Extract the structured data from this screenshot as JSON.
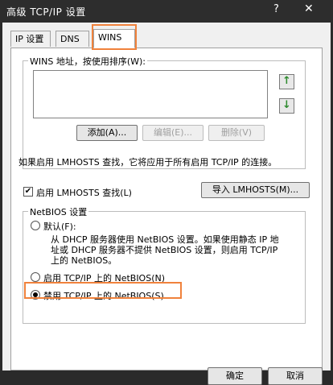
{
  "window": {
    "title": "高级 TCP/IP 设置",
    "help_glyph": "?",
    "close_glyph": "✕"
  },
  "tabs": [
    {
      "label": "IP 设置"
    },
    {
      "label": "DNS"
    },
    {
      "label": "WINS",
      "active": true
    }
  ],
  "wins_address": {
    "group_label": "WINS 地址，按使用排序(W):",
    "up_glyph": "↑",
    "down_glyph": "↓",
    "add_label": "添加(A)...",
    "edit_label": "编辑(E)...",
    "delete_label": "删除(V)"
  },
  "lmhosts": {
    "description": "如果启用 LMHOSTS 查找，它将应用于所有启用 TCP/IP 的连接。",
    "enable_label": "启用 LMHOSTS 查找(L)",
    "enable_checked": true,
    "check_glyph": "✔",
    "import_label": "导入 LMHOSTS(M)..."
  },
  "netbios": {
    "group_label": "NetBIOS 设置",
    "default_label": "默认(F):",
    "default_desc_1": "从 DHCP 服务器使用 NetBIOS 设置。如果使用静态 IP 地",
    "default_desc_2": "址或 DHCP 服务器不提供 NetBIOS 设置，则启用 TCP/IP",
    "default_desc_3": "上的 NetBIOS。",
    "enable_label": "启用 TCP/IP 上的 NetBIOS(N)",
    "disable_label": "禁用 TCP/IP 上的 NetBIOS(S)",
    "selected": "disable"
  },
  "footer": {
    "ok_label": "确定",
    "cancel_label": "取消"
  },
  "colors": {
    "highlight": "#f0823c",
    "arrow_green": "#2e8b2e"
  }
}
